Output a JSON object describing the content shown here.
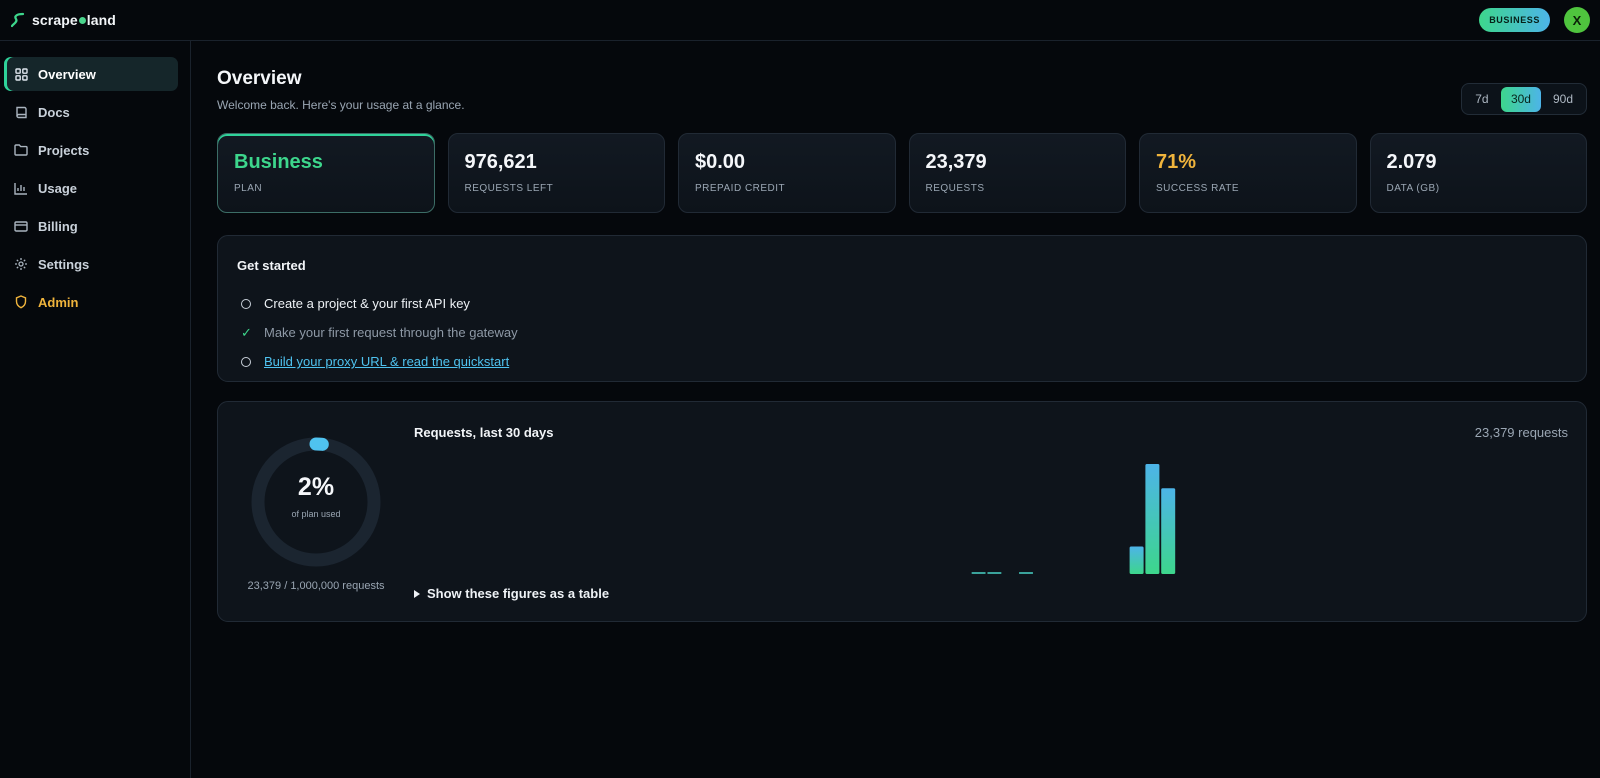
{
  "brand": {
    "name_before": "scrape",
    "name_after": "land"
  },
  "header": {
    "plan_badge": "BUSINESS",
    "avatar_initial": "X"
  },
  "sidebar": {
    "items": [
      {
        "label": "Overview",
        "icon": "grid-icon"
      },
      {
        "label": "Docs",
        "icon": "book-icon"
      },
      {
        "label": "Projects",
        "icon": "folder-icon"
      },
      {
        "label": "Usage",
        "icon": "bar-chart-icon"
      },
      {
        "label": "Billing",
        "icon": "credit-card-icon"
      },
      {
        "label": "Settings",
        "icon": "gear-icon"
      },
      {
        "label": "Admin",
        "icon": "shield-icon"
      }
    ]
  },
  "page": {
    "title": "Overview",
    "subtitle": "Welcome back. Here's your usage at a glance."
  },
  "range": {
    "options": [
      "7d",
      "30d",
      "90d"
    ],
    "selected": "30d"
  },
  "stats": [
    {
      "value": "Business",
      "label": "PLAN"
    },
    {
      "value": "976,621",
      "label": "REQUESTS LEFT"
    },
    {
      "value": "$0.00",
      "label": "PREPAID CREDIT"
    },
    {
      "value": "23,379",
      "label": "REQUESTS"
    },
    {
      "value": "71%",
      "label": "SUCCESS RATE"
    },
    {
      "value": "2.079",
      "label": "DATA (GB)"
    }
  ],
  "get_started": {
    "title": "Get started",
    "tasks": [
      {
        "text": "Create a project & your first API key",
        "status": "pending"
      },
      {
        "text": "Make your first request through the gateway",
        "status": "done"
      },
      {
        "text": "Build your proxy URL & read the quickstart",
        "status": "link"
      }
    ]
  },
  "usage": {
    "percent_label": "2%",
    "percent_sub": "of plan used",
    "used_fraction": 0.023379,
    "caption": "23,379 / 1,000,000 requests",
    "show_table_label": "Show these figures as a table"
  },
  "colors": {
    "accent_green": "#3dd68c",
    "accent_blue": "#4db4e8",
    "warning": "#f0b43c"
  },
  "chart_data": {
    "type": "bar",
    "title": "Requests, last 30 days",
    "total_label": "23,379 requests",
    "xlabel": "",
    "ylabel": "",
    "grid": false,
    "days": 30,
    "values": [
      0,
      0,
      0,
      0,
      0,
      0,
      0,
      0,
      0,
      0,
      0,
      0,
      0,
      0,
      0,
      0,
      0,
      0,
      0,
      0,
      0,
      0,
      40,
      30,
      0,
      60,
      0,
      0,
      0,
      0,
      0,
      0,
      2500,
      10000,
      7800,
      0,
      0
    ]
  }
}
